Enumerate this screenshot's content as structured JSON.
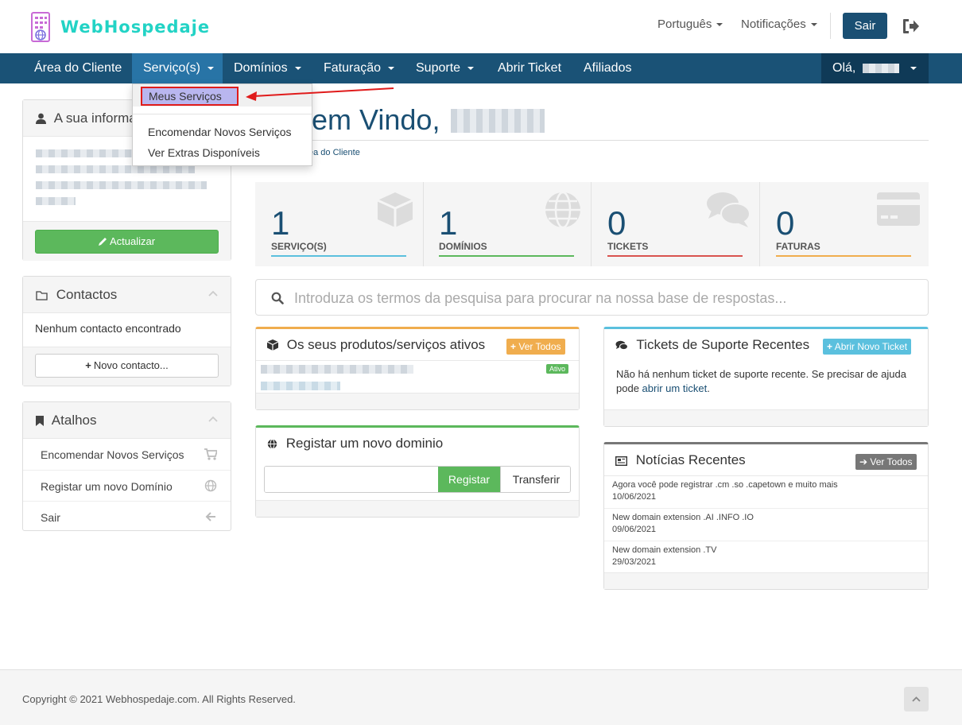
{
  "header": {
    "logo_text": "WebHospedaje",
    "language_label": "Português",
    "notifications_label": "Notificações",
    "logout_label": "Sair"
  },
  "nav": {
    "items": [
      "Área do Cliente",
      "Serviço(s)",
      "Domínios",
      "Faturação",
      "Suporte",
      "Abrir Ticket",
      "Afiliados"
    ],
    "greeting": "Olá,"
  },
  "dropdown": {
    "selected": "Meus Serviços",
    "items": [
      "Encomendar Novos Serviços",
      "Ver Extras Disponíveis"
    ]
  },
  "sidebar": {
    "info_title": "A sua informação",
    "update_label": "Actualizar",
    "contacts_title": "Contactos",
    "contacts_empty": "Nenhum contacto encontrado",
    "new_contact_label": "Novo contacto...",
    "shortcuts_title": "Atalhos",
    "shortcuts": [
      "Encomendar Novos Serviços",
      "Registar um novo Domínio",
      "Sair"
    ]
  },
  "main": {
    "welcome": "Bem Vindo,",
    "breadcrumb": "Área do Cliente",
    "stats": [
      {
        "value": "1",
        "label": "SERVIÇO(S)",
        "color": "#5bc0de"
      },
      {
        "value": "1",
        "label": "DOMÍNIOS",
        "color": "#5cb85c"
      },
      {
        "value": "0",
        "label": "TICKETS",
        "color": "#d9534f"
      },
      {
        "value": "0",
        "label": "FATURAS",
        "color": "#f0ad4e"
      }
    ],
    "search_placeholder": "Introduza os termos da pesquisa para procurar na nossa base de respostas..."
  },
  "products": {
    "title": "Os seus produtos/serviços ativos",
    "view_all": "Ver Todos",
    "status": "Ativo"
  },
  "domain_register": {
    "title": "Registar um novo dominio",
    "register_label": "Registar",
    "transfer_label": "Transferir"
  },
  "tickets": {
    "title": "Tickets de Suporte Recentes",
    "open_label": "Abrir Novo Ticket",
    "empty_text": "Não há nenhum ticket de suporte recente. Se precisar de ajuda pode",
    "empty_link": "abrir um ticket",
    "empty_end": "."
  },
  "news": {
    "title": "Notícias Recentes",
    "view_all": "Ver Todos",
    "items": [
      {
        "title": "Agora você pode registrar .cm .so .capetown e muito mais",
        "date": "10/06/2021"
      },
      {
        "title": "New domain extension .AI .INFO .IO",
        "date": "09/06/2021"
      },
      {
        "title": "New domain extension .TV",
        "date": "29/03/2021"
      }
    ]
  },
  "footer": {
    "copyright": "Copyright © 2021 Webhospedaje.com. All Rights Reserved."
  },
  "colors": {
    "navbar": "#1a5276",
    "brand": "#22d3c5",
    "primary": "#1a4f73"
  }
}
